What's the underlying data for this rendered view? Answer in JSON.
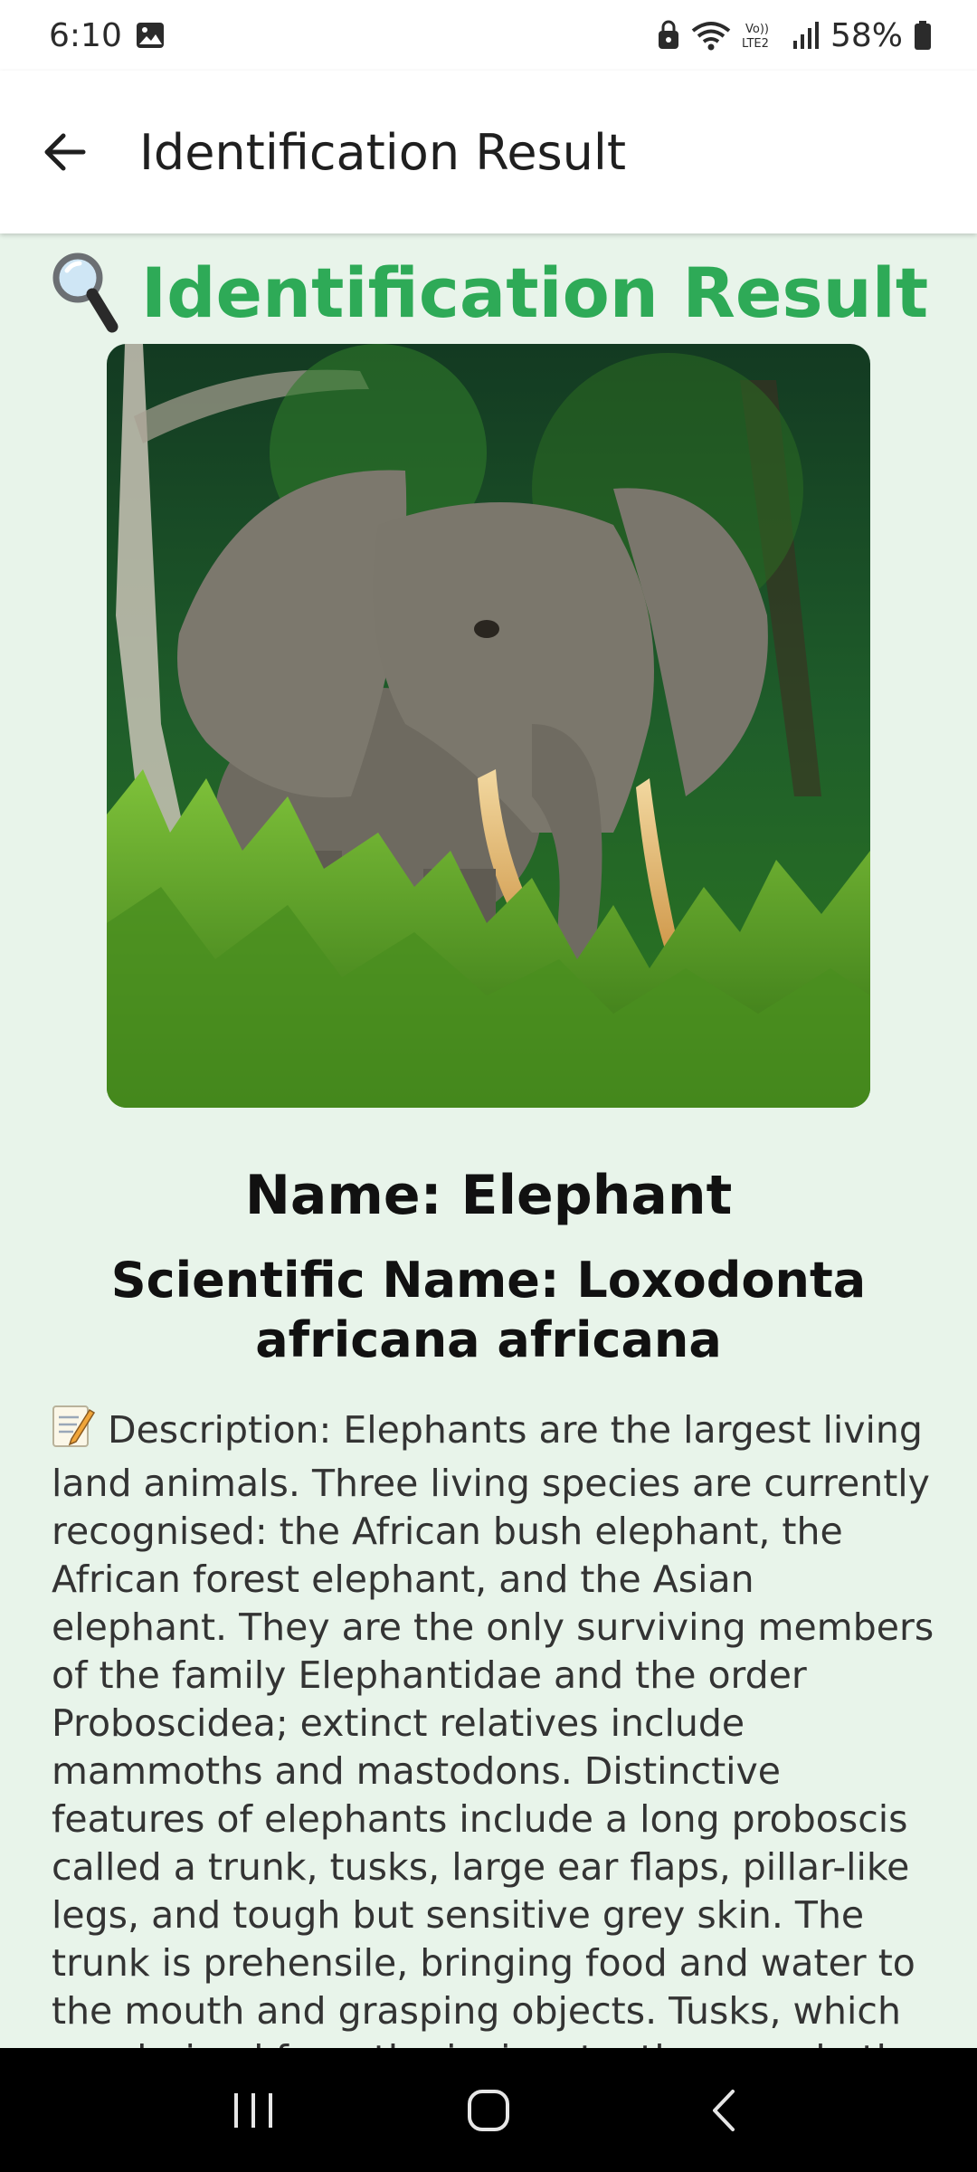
{
  "status_bar": {
    "time": "6:10",
    "battery": "58%",
    "icons": [
      "gallery-icon",
      "lock-icon",
      "wifi-icon",
      "volte-icon",
      "signal-icon",
      "battery-icon"
    ]
  },
  "app_bar": {
    "title": "Identification Result",
    "back_icon": "arrow-left-icon"
  },
  "result": {
    "heading_emoji": "magnifying-glass-icon",
    "heading": "Identification Result",
    "image_subject": "elephant-photo",
    "name": "Name: Elephant",
    "scientific_name": "Scientific Name: Loxodonta africana africana",
    "description_icon": "memo-icon",
    "description": "Description: Elephants are the largest living land animals. Three living species are currently recognised: the African bush elephant, the African forest elephant, and the Asian elephant. They are the only surviving members of the family Elephantidae and the order Proboscidea; extinct relatives include mammoths and mastodons. Distinctive features of elephants include a long proboscis called a trunk, tusks, large ear flaps, pillar-like legs, and tough but sensitive grey skin. The trunk is prehensile, bringing food and water to the mouth and grasping objects. Tusks, which are derived from the incisor teeth, serve both as weapons and"
  },
  "nav_bar": {
    "buttons": [
      "recents-icon",
      "home-icon",
      "back-icon"
    ]
  },
  "colors": {
    "accent": "#2eaa57",
    "background": "#e8f4ea"
  }
}
